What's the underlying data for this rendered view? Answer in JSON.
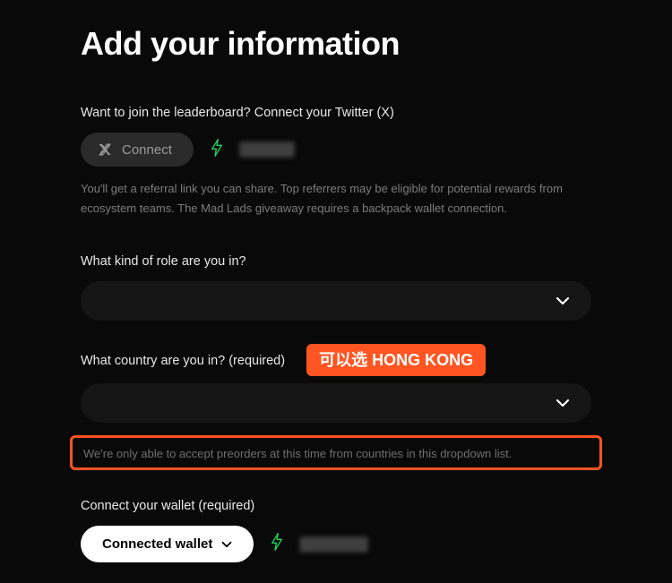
{
  "heading": "Add your information",
  "twitter": {
    "label": "Want to join the leaderboard? Connect your Twitter (X)",
    "connect_label": "Connect",
    "help": "You'll get a referral link you can share. Top referrers may be eligible for potential rewards from ecosystem teams. The Mad Lads giveaway requires a backpack wallet connection."
  },
  "role": {
    "label": "What kind of role are you in?"
  },
  "country": {
    "label": "What country are you in? (required)",
    "annotation": "可以选 HONG KONG",
    "note": "We're only able to accept preorders at this time from countries in this dropdown list."
  },
  "wallet": {
    "label": "Connect your wallet (required)",
    "button_label": "Connected wallet"
  },
  "colors": {
    "accent_orange": "#ff5522",
    "accent_green": "#1ed760"
  }
}
